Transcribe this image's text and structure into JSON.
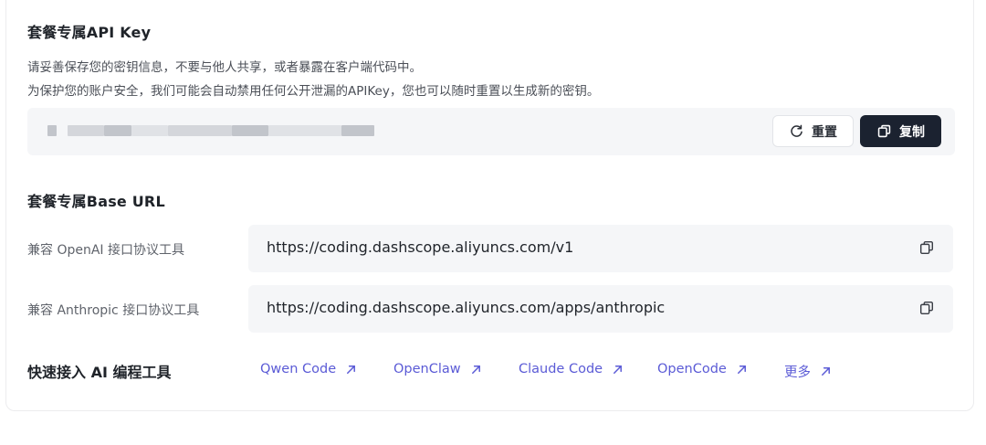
{
  "apikey_section": {
    "title": "套餐专属API Key",
    "desc_line1": "请妥善保存您的密钥信息，不要与他人共享，或者暴露在客户端代码中。",
    "desc_line2": "为保护您的账户安全，我们可能会自动禁用任何公开泄漏的APIKey，您也可以随时重置以生成新的密钥。",
    "reset_label": "重置",
    "copy_label": "复制"
  },
  "baseurl_section": {
    "title": "套餐专属Base URL",
    "rows": [
      {
        "label": "兼容 OpenAI 接口协议工具",
        "url": "https://coding.dashscope.aliyuncs.com/v1"
      },
      {
        "label": "兼容 Anthropic 接口协议工具",
        "url": "https://coding.dashscope.aliyuncs.com/apps/anthropic"
      }
    ]
  },
  "quick_access": {
    "title": "快速接入 AI 编程工具",
    "links": [
      "Qwen Code",
      "OpenClaw",
      "Claude Code",
      "OpenCode",
      "更多"
    ]
  },
  "icons": {
    "reset": "refresh-icon",
    "copy": "copy-icon",
    "external": "arrow-up-right-icon"
  },
  "colors": {
    "primary_button_bg": "#1b2230",
    "link": "#5b5bd6",
    "field_bg": "#f5f6f8"
  }
}
